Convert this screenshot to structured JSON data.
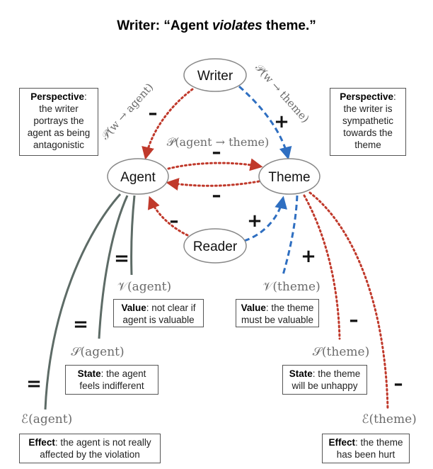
{
  "title": {
    "prefix": "Writer: “Agent ",
    "verb": "violates",
    "suffix": " theme.”"
  },
  "nodes": {
    "writer": "Writer",
    "agent": "Agent",
    "theme": "Theme",
    "reader": "Reader"
  },
  "edge_labels": {
    "p_w_agent": "𝒫(w → agent)",
    "p_w_theme": "𝒫(w → theme)",
    "p_agent_theme": "𝒫(agent → theme)",
    "v_agent": "𝒱(agent)",
    "v_theme": "𝒱(theme)",
    "s_agent": "𝒮(agent)",
    "s_theme": "𝒮(theme)",
    "e_agent": "ℰ(agent)",
    "e_theme": "ℰ(theme)"
  },
  "signs": {
    "writer_agent": "–",
    "writer_theme": "+",
    "agent_theme_top": "–",
    "agent_theme_bottom": "–",
    "reader_agent": "–",
    "reader_theme": "+",
    "v_agent": "=",
    "v_theme": "+",
    "s_agent": "=",
    "s_theme": "–",
    "e_agent": "=",
    "e_theme": "–"
  },
  "boxes": {
    "perspective_agent": {
      "head": "Perspective",
      "text": ": the writer portrays the agent as being antagonistic"
    },
    "perspective_theme": {
      "head": "Perspective",
      "text": ": the writer is sympathetic towards the theme"
    },
    "value_agent": {
      "head": "Value",
      "text": ": not clear if agent is valuable"
    },
    "value_theme": {
      "head": "Value",
      "text": ": the theme must be valuable"
    },
    "state_agent": {
      "head": "State",
      "text": ": the agent feels indifferent"
    },
    "state_theme": {
      "head": "State",
      "text": ": the theme will be unhappy"
    },
    "effect_agent": {
      "head": "Effect",
      "text": ": the agent is not really affected by the violation"
    },
    "effect_theme": {
      "head": "Effect",
      "text": ": the theme has been hurt"
    }
  },
  "colors": {
    "negative": "#c0392b",
    "positive": "#2f6fc1",
    "neutral": "#5d6b66",
    "formula": "#6b6b6b"
  }
}
